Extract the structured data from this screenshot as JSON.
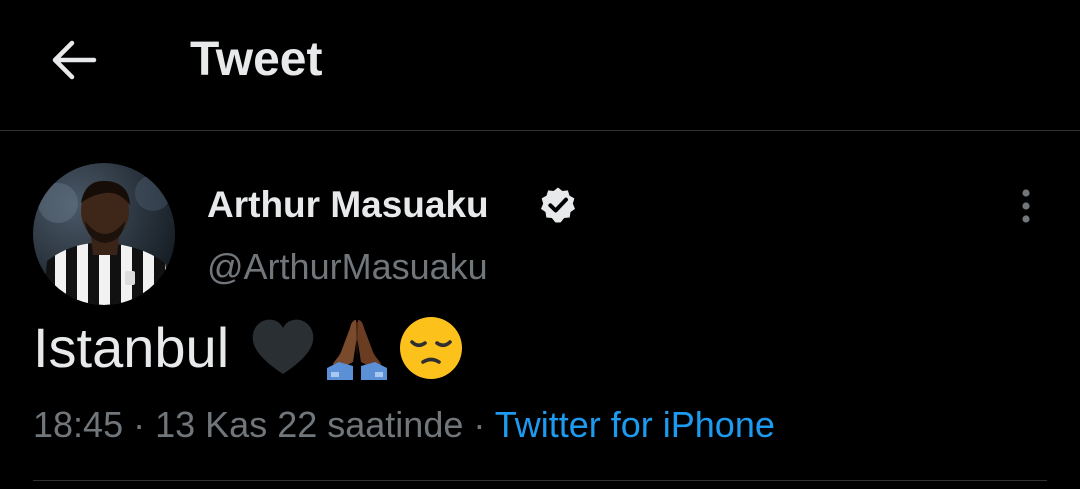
{
  "header": {
    "title": "Tweet",
    "back_icon": "arrow-left-icon"
  },
  "tweet": {
    "author_name": "Arthur Masuaku",
    "handle": "@ArthurMasuaku",
    "verified_icon": "verified-badge-icon",
    "more_icon": "more-vertical-icon",
    "text": "Istanbul",
    "emojis": [
      "black-heart-icon",
      "folded-hands-dark-icon",
      "disappointed-face-icon"
    ],
    "time": "18:45",
    "separator": "·",
    "date": "13 Kas 22 saatinde",
    "source": "Twitter for iPhone"
  },
  "colors": {
    "background": "#000000",
    "text": "#e7e9ea",
    "secondary": "#71767b",
    "link": "#1d9bf0",
    "divider": "#2f3336"
  }
}
